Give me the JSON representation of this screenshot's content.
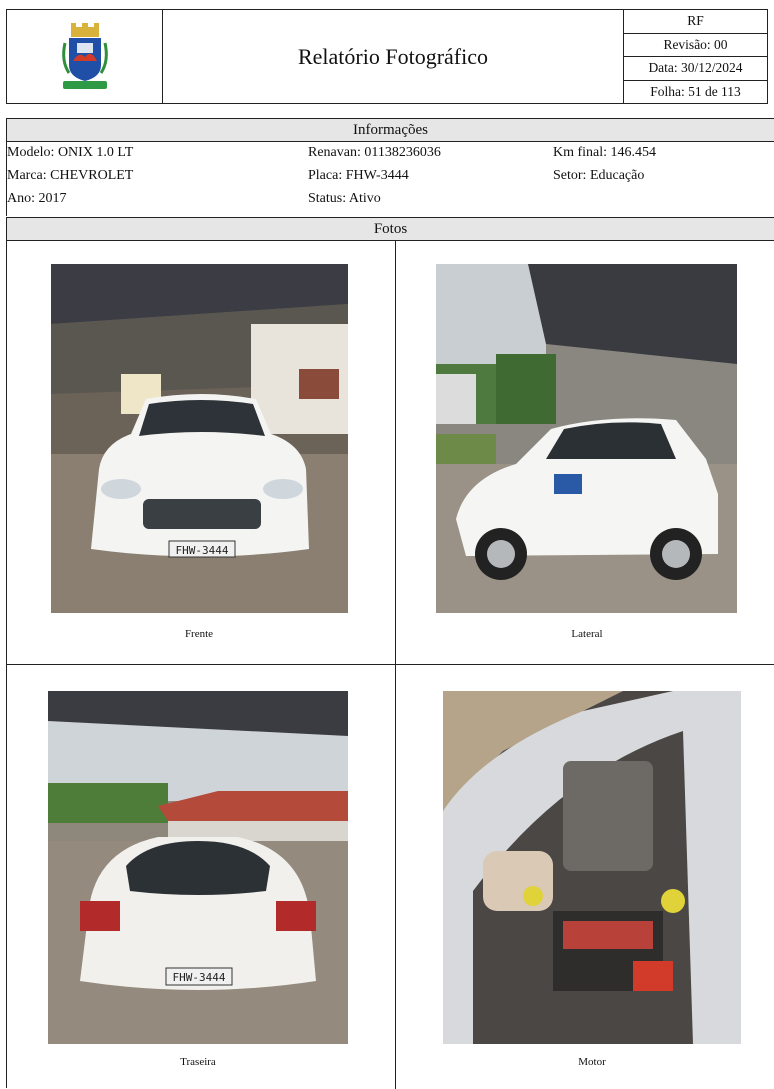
{
  "header": {
    "title": "Relatório Fotográfico",
    "code": "RF",
    "revision": "Revisão: 00",
    "date": "Data: 30/12/2024",
    "sheet": "Folha: 51 de 113",
    "logo_icon": "municipal-coat-of-arms-icon"
  },
  "info": {
    "section_title": "Informações",
    "modelo": "Modelo: ONIX 1.0 LT",
    "marca": "Marca: CHEVROLET",
    "ano": "Ano: 2017",
    "renavan": "Renavan: 01138236036",
    "placa": "Placa: FHW-3444",
    "status": "Status: Ativo",
    "km_final": "Km final: 146.454",
    "setor": "Setor: Educação"
  },
  "fotos": {
    "section_title": "Fotos",
    "items": [
      {
        "caption": "Frente"
      },
      {
        "caption": "Lateral"
      },
      {
        "caption": "Traseira"
      },
      {
        "caption": "Motor"
      }
    ],
    "plate_text": "FHW-3444"
  }
}
